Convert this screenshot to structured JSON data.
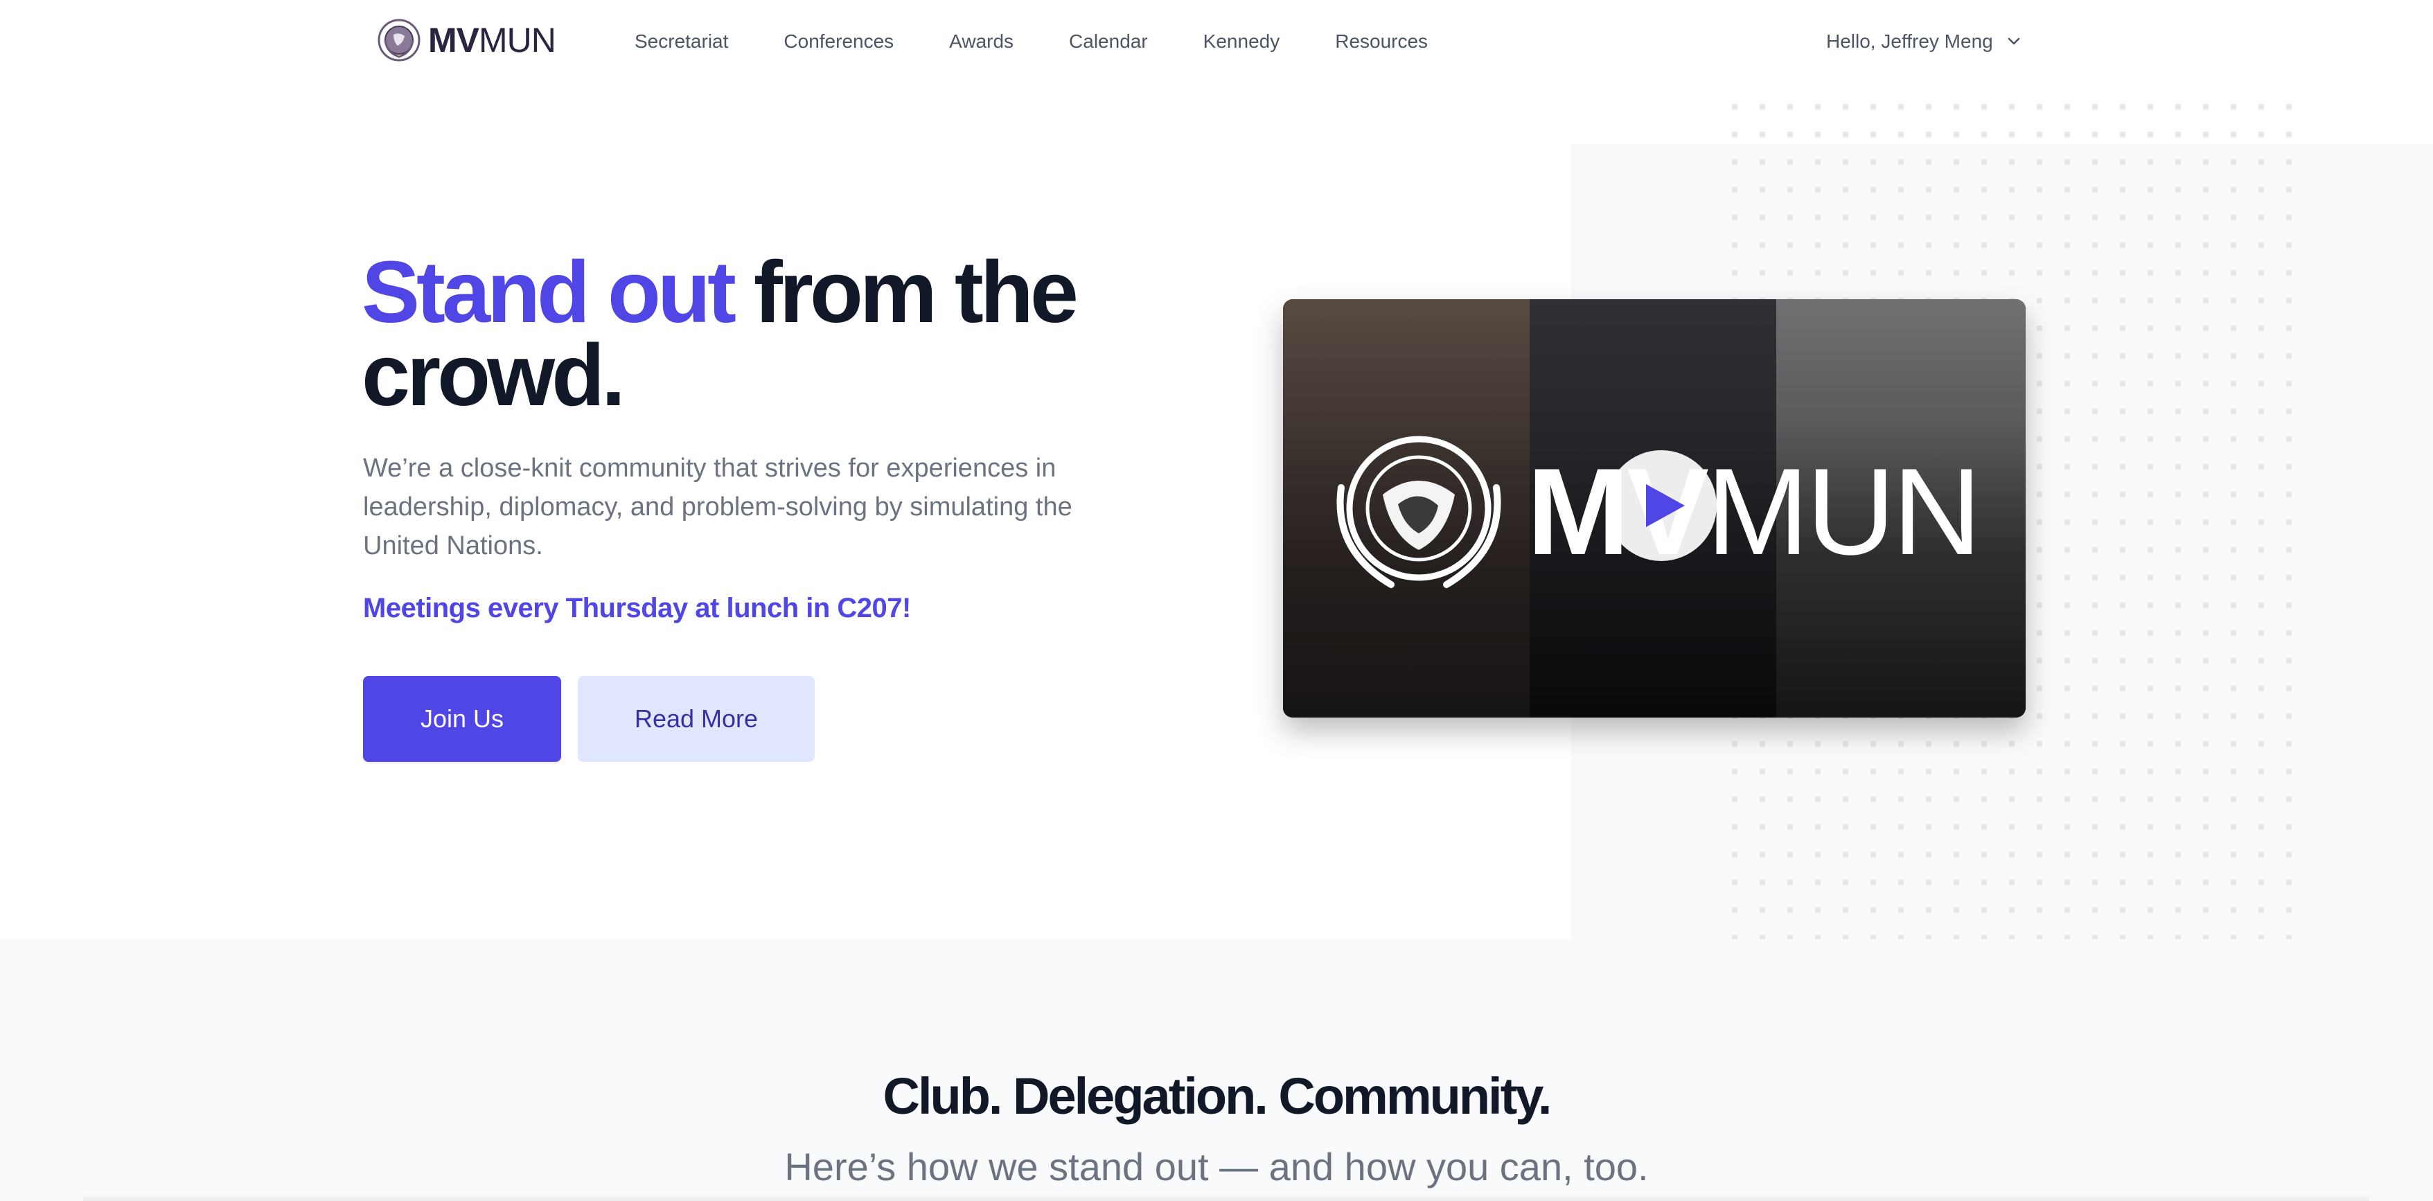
{
  "brand": {
    "logo_bold": "MV",
    "logo_light": "MUN",
    "emblem_icon": "un-emblem-icon",
    "accent_color": "#4f46e5"
  },
  "nav": {
    "links": [
      {
        "label": "Secretariat"
      },
      {
        "label": "Conferences"
      },
      {
        "label": "Awards"
      },
      {
        "label": "Calendar"
      },
      {
        "label": "Kennedy"
      },
      {
        "label": "Resources"
      }
    ],
    "user_greeting": "Hello, Jeffrey Meng"
  },
  "hero": {
    "title_accent": "Stand out",
    "title_rest": "from the crowd.",
    "description": "We’re a close-knit community that strives for experiences in leadership, diplomacy, and problem-solving by simulating the United Nations.",
    "meetings": "Meetings every Thursday at lunch in C207!",
    "join_button": "Join Us",
    "read_more_button": "Read More"
  },
  "video": {
    "title_bold": "MV",
    "title_light": "MUN",
    "play_icon": "play-icon"
  },
  "section2": {
    "title": "Club. Delegation. Community.",
    "subtitle": "Here’s how we stand out — and how you can, too."
  }
}
